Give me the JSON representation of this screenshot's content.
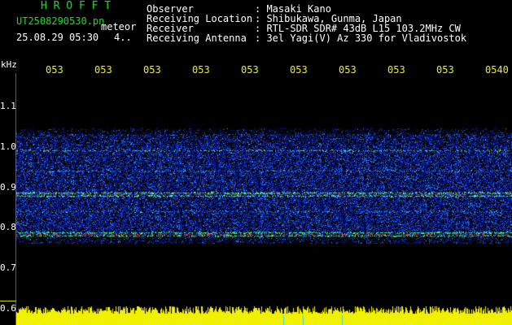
{
  "header": {
    "app_name": "H R O F F T",
    "filename": "UT2508290530.pn",
    "mode": "meteor",
    "datetime": "25.08.29 05:30",
    "count": "4..",
    "observer_label": "Observer",
    "observer_value": ": Masaki Kano",
    "location_label": "Receiving Location",
    "location_value": ": Shibukawa, Gunma, Japan",
    "receiver_label": "Receiver",
    "receiver_value": ": RTL-SDR SDR# 43dB L15 103.2MHz CW",
    "antenna_label": "Receiving Antenna",
    "antenna_value": ": 3el Yagi(V) Az 330 for Vladivostok"
  },
  "axis": {
    "unit": "kHz",
    "y_ticks": [
      "1.1",
      "1.0",
      "0.9",
      "0.8",
      "0.7",
      "0.6"
    ],
    "x_ticks": [
      "053",
      "053",
      "053",
      "053",
      "053",
      "053",
      "053",
      "053",
      "053",
      "0540"
    ]
  },
  "colors": {
    "background": "#000000",
    "header_green": "#18e018",
    "header_white": "#ffffff",
    "tick_yellow": "#f3f000",
    "noise_blue": "#1030d0",
    "echo_green": "#30ff60",
    "echo_red": "#ff3030",
    "amplitude_yellow": "#f0f000"
  }
}
